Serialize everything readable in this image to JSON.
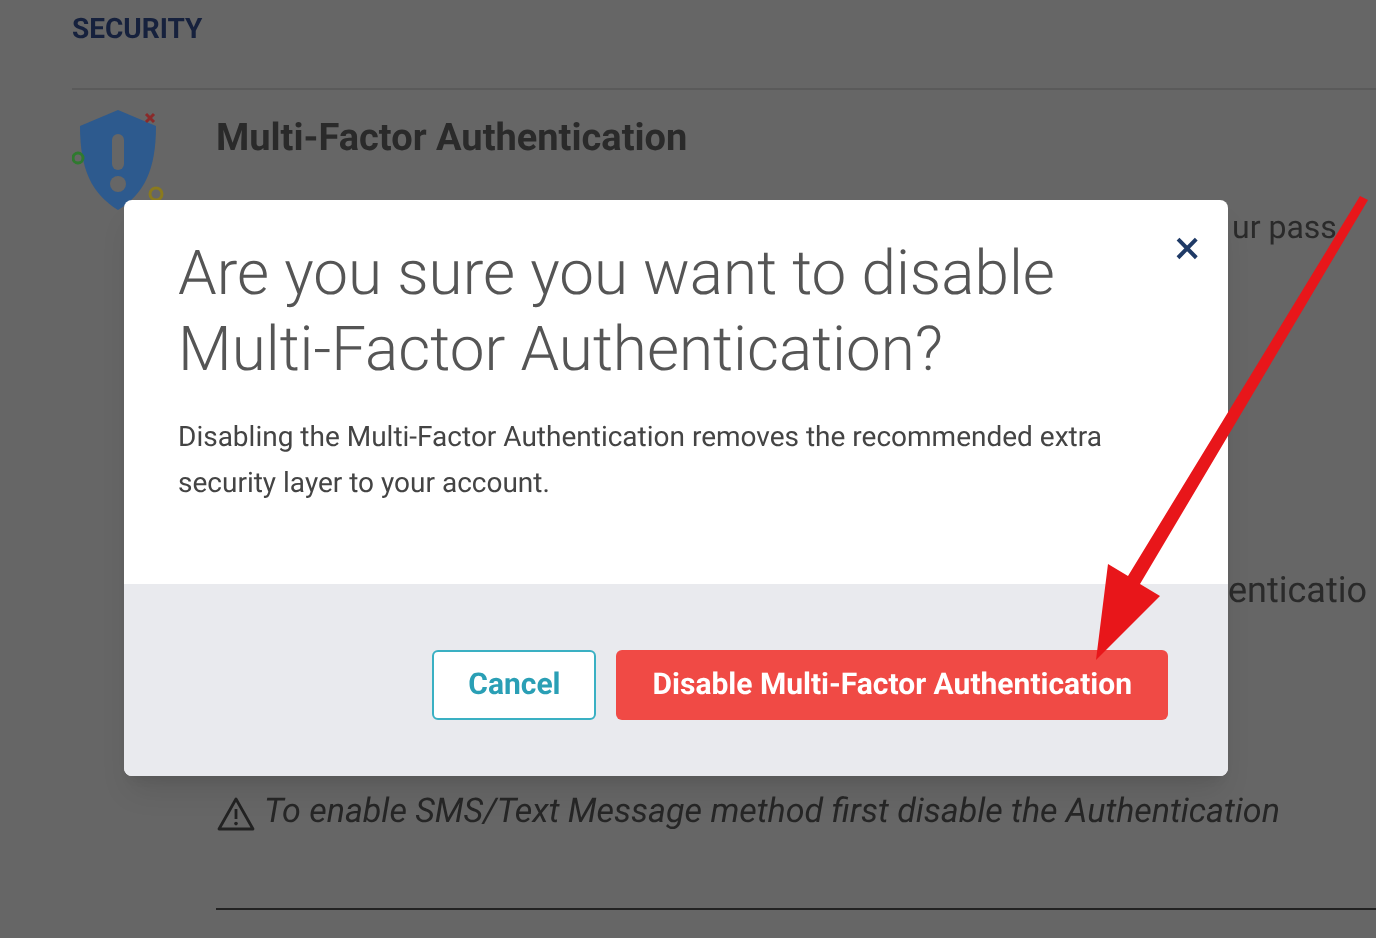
{
  "page": {
    "section_heading": "SECURITY",
    "feature_title": "Multi-Factor Authentication",
    "fragment_1": "ur pass",
    "fragment_2": "enticatio",
    "warning": "To enable SMS/Text Message method first disable the Authentication"
  },
  "dialog": {
    "title": "Are you sure you want to disable Multi-Factor Authentication?",
    "message": "Disabling the Multi-Factor Authentication removes the recommended extra security layer to your account.",
    "close": "×",
    "buttons": [
      {
        "label": "Cancel",
        "kind": "secondary"
      },
      {
        "label": "Disable Multi-Factor Authentication",
        "kind": "danger"
      }
    ]
  }
}
